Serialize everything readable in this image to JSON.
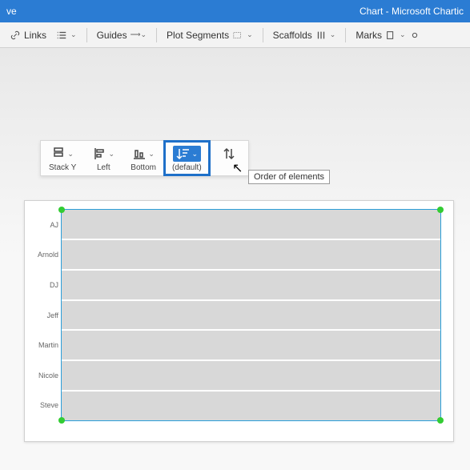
{
  "titlebar": {
    "left": "ve",
    "right": "Chart - Microsoft Chartic"
  },
  "ribbon": {
    "links": "Links",
    "guides": "Guides",
    "plot_segments": "Plot Segments",
    "scaffolds": "Scaffolds",
    "marks": "Marks"
  },
  "toolbar": {
    "stack_y": "Stack Y",
    "left": "Left",
    "bottom": "Bottom",
    "default": "(default)"
  },
  "tooltip": "Order of elements",
  "chart_data": {
    "type": "bar",
    "categories": [
      "AJ",
      "Arnold",
      "DJ",
      "Jeff",
      "Martin",
      "Nicole",
      "Steve"
    ],
    "values": [
      1,
      1,
      1,
      1,
      1,
      1,
      1
    ],
    "title": "",
    "xlabel": "",
    "ylabel": "",
    "ylim": [
      0,
      1
    ]
  }
}
